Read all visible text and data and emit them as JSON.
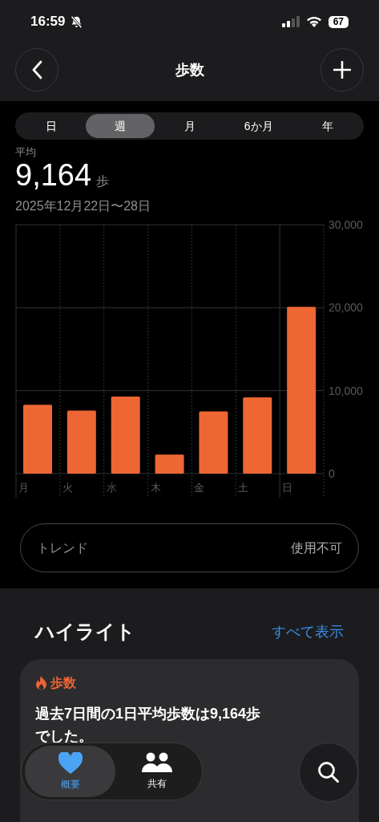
{
  "status_bar": {
    "time": "16:59",
    "battery": "67"
  },
  "nav": {
    "title": "歩数"
  },
  "segments": [
    {
      "label": "日",
      "selected": false
    },
    {
      "label": "週",
      "selected": true
    },
    {
      "label": "月",
      "selected": false
    },
    {
      "label": "6か月",
      "selected": false
    },
    {
      "label": "年",
      "selected": false
    }
  ],
  "summary": {
    "label": "平均",
    "value": "9,164",
    "unit": "歩",
    "date_range": "2025年12月22日〜28日"
  },
  "chart_data": {
    "type": "bar",
    "categories": [
      "月",
      "火",
      "水",
      "木",
      "金",
      "土",
      "日"
    ],
    "values": [
      8300,
      7600,
      9300,
      2300,
      7500,
      9200,
      20100
    ],
    "ylim": [
      0,
      30000
    ],
    "yticks": [
      {
        "value": 0,
        "label": "0"
      },
      {
        "value": 10000,
        "label": "10,000"
      },
      {
        "value": 20000,
        "label": "20,000"
      },
      {
        "value": 30000,
        "label": "30,000"
      }
    ]
  },
  "trend": {
    "label": "トレンド",
    "value": "使用不可"
  },
  "highlights": {
    "title": "ハイライト",
    "see_all": "すべて表示",
    "card": {
      "category": "歩数",
      "text": "過去7日間の1日平均歩数は9,164歩でした。"
    }
  },
  "tab_bar": {
    "items": [
      {
        "label": "概要",
        "selected": true,
        "kind": "heart"
      },
      {
        "label": "共有",
        "selected": false,
        "kind": "people"
      }
    ]
  }
}
